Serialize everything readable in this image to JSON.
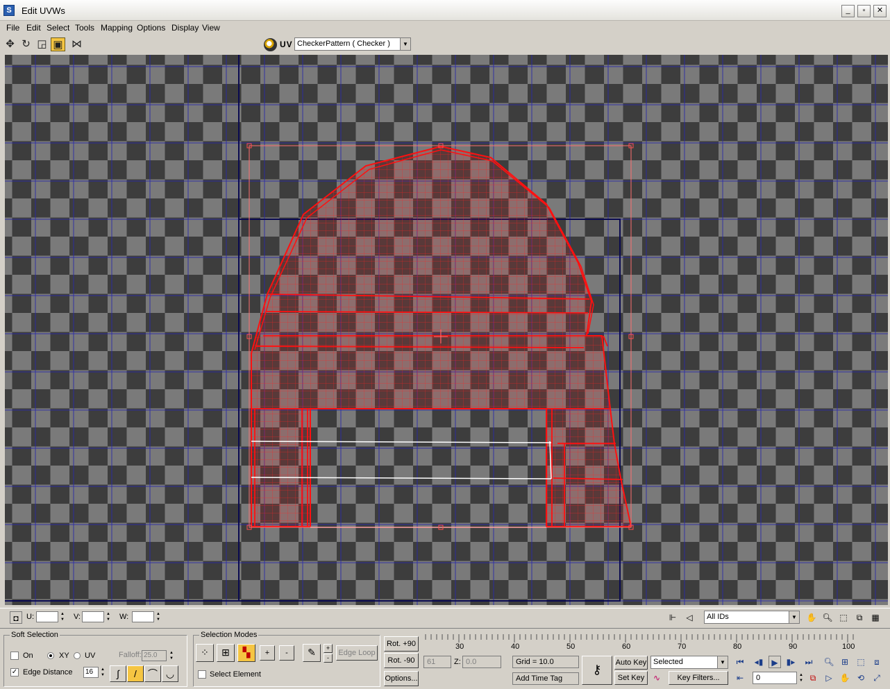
{
  "window": {
    "title": "Edit UVWs"
  },
  "menu": [
    "File",
    "Edit",
    "Select",
    "Tools",
    "Mapping",
    "Options",
    "Display",
    "View"
  ],
  "toolbar": {
    "uv_label": "UV",
    "map_select": "CheckerPattern  ( Checker )"
  },
  "status": {
    "u_label": "U:",
    "v_label": "V:",
    "w_label": "W:",
    "ids_select": "All IDs"
  },
  "soft_selection": {
    "title": "Soft Selection",
    "on_label": "On",
    "on_checked": false,
    "xy_label": "XY",
    "uv_label": "UV",
    "mode": "XY",
    "falloff_label": "Falloff:",
    "falloff_value": "25.0",
    "edge_distance_label": "Edge Distance",
    "edge_distance_checked": true,
    "edge_distance_value": "16"
  },
  "selection_modes": {
    "title": "Selection Modes",
    "plus": "+",
    "minus": "-",
    "small_plus": "+",
    "small_minus": "-",
    "edge_loop": "Edge Loop",
    "select_element_label": "Select Element",
    "select_element_checked": false
  },
  "rotate": {
    "plus": "Rot. +90",
    "minus": "Rot. -90",
    "options": "Options..."
  },
  "timeline": {
    "ticks": [
      "30",
      "40",
      "50",
      "60",
      "70",
      "80",
      "90",
      "100"
    ]
  },
  "anim": {
    "x_value": "61",
    "z_label": "Z:",
    "z_value": "0.0",
    "grid": "Grid = 10.0",
    "add_time_tag": "Add Time Tag",
    "auto_key": "Auto Key",
    "set_key": "Set Key",
    "key_mode": "Selected",
    "key_filters": "Key Filters...",
    "frame": "0"
  }
}
